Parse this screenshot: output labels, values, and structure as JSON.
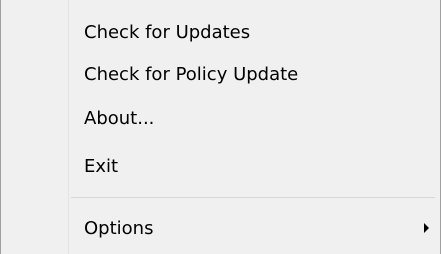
{
  "menu": {
    "items": [
      {
        "label": "Check for Updates"
      },
      {
        "label": "Check for Policy Update"
      },
      {
        "label": "About..."
      },
      {
        "label": "Exit"
      }
    ],
    "options": {
      "label": "Options",
      "arrow_icon": "submenu-arrow-icon"
    }
  }
}
